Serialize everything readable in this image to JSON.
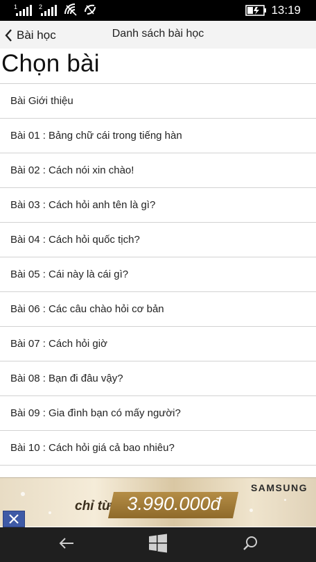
{
  "status_bar": {
    "time": "13:19",
    "sim1_label": "1",
    "sim2_label": "2",
    "icons": [
      "signal-sim1-icon",
      "signal-sim2-icon",
      "wifi-icon",
      "data-icon",
      "battery-charging-icon"
    ]
  },
  "header": {
    "back_label": "Bài học",
    "title": "Danh sách bài học"
  },
  "page": {
    "heading": "Chọn bài"
  },
  "lessons": [
    "Bài Giới thiệu",
    "Bài 01 : Bảng chữ cái trong tiếng hàn",
    "Bài 02 : Cách nói xin chào!",
    "Bài 03 : Cách hỏi anh tên là gì?",
    "Bài 04 : Cách hỏi quốc tịch?",
    "Bài 05 : Cái này là cái gì?",
    "Bài 06 : Các câu chào hỏi cơ bản",
    "Bài 07 : Cách hỏi giờ",
    "Bài 08 : Bạn đi đâu vậy?",
    "Bài 09 : Gia đình bạn có mấy người?",
    "Bài 10 : Cách hỏi giá cả bao nhiêu?"
  ],
  "ad": {
    "brand": "SAMSUNG",
    "prefix": "chỉ từ",
    "price": "3.990.000đ"
  },
  "navbar": {
    "icons": [
      "back-arrow-icon",
      "windows-logo-icon",
      "search-icon"
    ]
  },
  "colors": {
    "status_bar": "#000000",
    "header_bg": "#f3f3f3",
    "navbar_bg": "#1f1f1f",
    "ad_close_bg": "#3e5aa6"
  }
}
